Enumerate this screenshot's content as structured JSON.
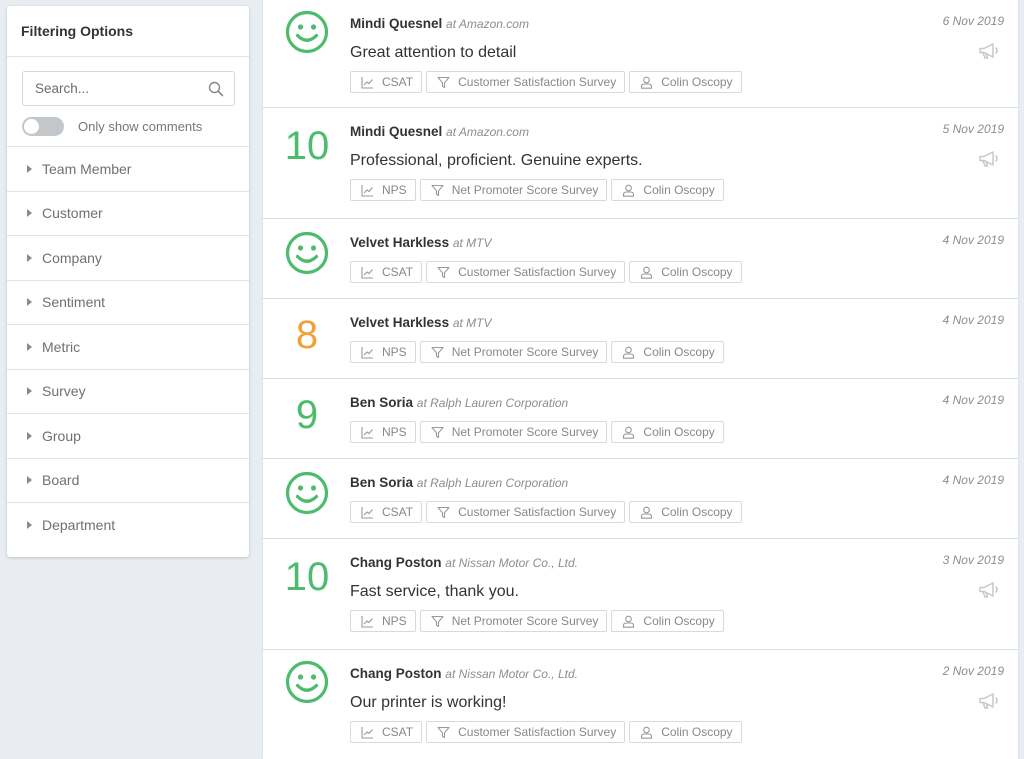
{
  "sidebar": {
    "title": "Filtering Options",
    "search_placeholder": "Search...",
    "toggle_label": "Only show comments",
    "toggle_on": false,
    "facets": [
      "Team Member",
      "Customer",
      "Company",
      "Sentiment",
      "Metric",
      "Survey",
      "Group",
      "Board",
      "Department"
    ]
  },
  "colors": {
    "score_green": "#4cbb6c",
    "score_orange": "#f0a13a",
    "smiley_green": "#4cbb6c"
  },
  "feed": [
    {
      "person": "Mindi Quesnel",
      "company": "at Amazon.com",
      "date": "6 Nov 2019",
      "score_type": "smiley",
      "score": "",
      "comment": "Great attention to detail",
      "metric": "CSAT",
      "survey": "Customer Satisfaction Survey",
      "agent": "Colin Oscopy"
    },
    {
      "person": "Mindi Quesnel",
      "company": "at Amazon.com",
      "date": "5 Nov 2019",
      "score_type": "number",
      "score": "10",
      "score_color": "green",
      "comment": "Professional, proficient. Genuine experts.",
      "metric": "NPS",
      "survey": "Net Promoter Score Survey",
      "agent": "Colin Oscopy"
    },
    {
      "person": "Velvet Harkless",
      "company": "at MTV",
      "date": "4 Nov 2019",
      "score_type": "smiley",
      "score": "",
      "comment": "",
      "metric": "CSAT",
      "survey": "Customer Satisfaction Survey",
      "agent": "Colin Oscopy"
    },
    {
      "person": "Velvet Harkless",
      "company": "at MTV",
      "date": "4 Nov 2019",
      "score_type": "number",
      "score": "8",
      "score_color": "orange",
      "comment": "",
      "metric": "NPS",
      "survey": "Net Promoter Score Survey",
      "agent": "Colin Oscopy"
    },
    {
      "person": "Ben Soria",
      "company": "at Ralph Lauren Corporation",
      "date": "4 Nov 2019",
      "score_type": "number",
      "score": "9",
      "score_color": "green",
      "comment": "",
      "metric": "NPS",
      "survey": "Net Promoter Score Survey",
      "agent": "Colin Oscopy"
    },
    {
      "person": "Ben Soria",
      "company": "at Ralph Lauren Corporation",
      "date": "4 Nov 2019",
      "score_type": "smiley",
      "score": "",
      "comment": "",
      "metric": "CSAT",
      "survey": "Customer Satisfaction Survey",
      "agent": "Colin Oscopy"
    },
    {
      "person": "Chang Poston",
      "company": "at Nissan Motor Co., Ltd.",
      "date": "3 Nov 2019",
      "score_type": "number",
      "score": "10",
      "score_color": "green",
      "comment": "Fast service, thank you.",
      "metric": "NPS",
      "survey": "Net Promoter Score Survey",
      "agent": "Colin Oscopy"
    },
    {
      "person": "Chang Poston",
      "company": "at Nissan Motor Co., Ltd.",
      "date": "2 Nov 2019",
      "score_type": "smiley",
      "score": "",
      "comment": "Our printer is working!",
      "metric": "CSAT",
      "survey": "Customer Satisfaction Survey",
      "agent": "Colin Oscopy"
    }
  ]
}
